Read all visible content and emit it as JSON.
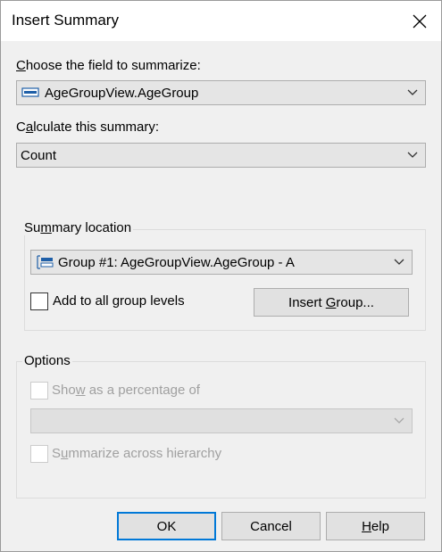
{
  "window": {
    "title": "Insert Summary"
  },
  "field": {
    "label_pre": "",
    "label_u": "C",
    "label_post": "hoose the field to summarize:",
    "value": "AgeGroupView.AgeGroup"
  },
  "calc": {
    "label_pre": "C",
    "label_u": "a",
    "label_post": "lculate this summary:",
    "value": "Count"
  },
  "location": {
    "title_pre": "Su",
    "title_u": "m",
    "title_post": "mary location",
    "group_value": "Group #1: AgeGroupView.AgeGroup - A",
    "add_all_label": "Add to all group levels",
    "add_all_checked": false,
    "insert_group_pre": "Insert ",
    "insert_group_u": "G",
    "insert_group_post": "roup..."
  },
  "options": {
    "title": "Options",
    "percentage_pre": "Sho",
    "percentage_u": "w",
    "percentage_post": " as a percentage of",
    "percentage_value": "",
    "summarize_pre": "S",
    "summarize_u": "u",
    "summarize_post": "mmarize across hierarchy"
  },
  "buttons": {
    "ok": "OK",
    "cancel": "Cancel",
    "help_u": "H",
    "help_post": "elp"
  },
  "colors": {
    "default_button_border": "#0078d7",
    "field_icon": "#1e5fa8"
  }
}
